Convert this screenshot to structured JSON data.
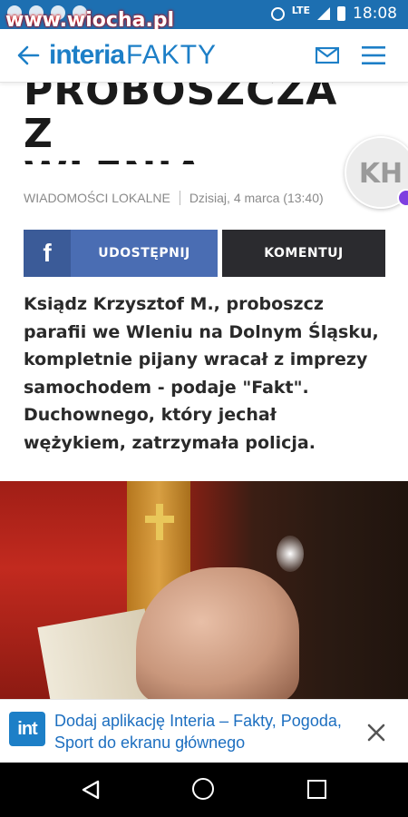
{
  "status_bar": {
    "watermark": "www.wiocha.pl",
    "network": "LTE",
    "time": "18:08"
  },
  "header": {
    "brand": "interia",
    "section": "FAKTY"
  },
  "article": {
    "headline_line1": "PROBOSZCZA Z",
    "headline_line2": "WLENIA",
    "author_initials": "KH",
    "category": "WIADOMOŚCI LOKALNE",
    "date": "Dzisiaj, 4 marca (13:40)",
    "share_label": "UDOSTĘPNIJ",
    "comment_label": "KOMENTUJ",
    "lead": "Ksiądz Krzysztof M., proboszcz parafii we Wleniu na Dolnym Śląsku, kompletnie pijany wracał z imprezy samochodem - podaje \"Fakt\". Duchownego, który jechał wężykiem, zatrzymała policja."
  },
  "app_banner": {
    "icon_text": "int",
    "text": "Dodaj aplikację Interia – Fakty, Pogoda, Sport do ekranu głównego"
  },
  "colors": {
    "status_bar": "#1d6fb1",
    "brand_blue": "#1d7fc7",
    "facebook_blue": "#4a6db3",
    "comment_dark": "#2b2b2f"
  },
  "icons": [
    "back-arrow-icon",
    "mail-icon",
    "menu-icon",
    "facebook-icon",
    "close-icon",
    "nav-back-icon",
    "nav-home-icon",
    "nav-recent-icon"
  ]
}
